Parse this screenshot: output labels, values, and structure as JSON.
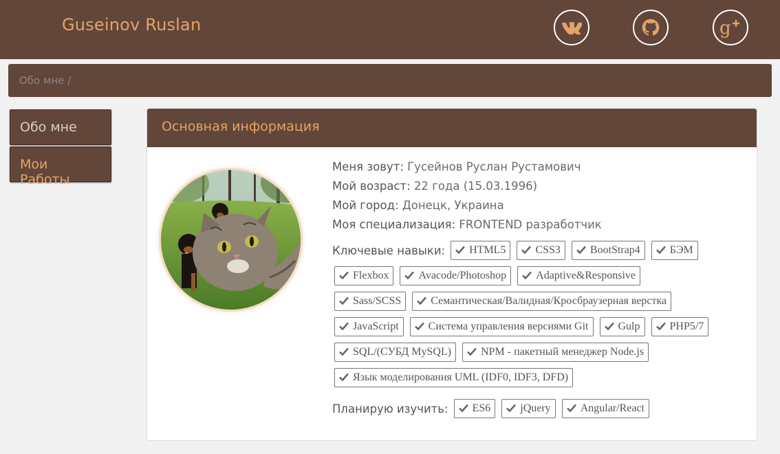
{
  "header": {
    "brand": "Guseinov Ruslan",
    "social": [
      {
        "icon": "vk-icon"
      },
      {
        "icon": "github-icon"
      },
      {
        "icon": "google-plus-icon"
      }
    ]
  },
  "breadcrumb": {
    "text": "Обо мне /"
  },
  "nav": {
    "items": [
      {
        "label": "Обо мне"
      },
      {
        "label": "Мои Работы"
      }
    ]
  },
  "card": {
    "title": "Основная информация",
    "info": [
      {
        "key": "Меня зовут:",
        "value": " Гусейнов Руслан Рустамович"
      },
      {
        "key": "Мой возраст:",
        "value": " 22 года (15.03.1996)"
      },
      {
        "key": "Мой город:",
        "value": " Донецк, Украина"
      },
      {
        "key": "Моя специализация:",
        "value": " FRONTEND разработчик"
      }
    ],
    "skills_label": "Ключевые навыки:",
    "skill_rows": [
      [
        "HTML5",
        "CSS3",
        "BootStrap4",
        "БЭМ"
      ],
      [
        "Flexbox",
        "Avacode/Photoshop",
        "Adaptive&Responsive"
      ],
      [
        "Sass/SCSS",
        "Семантическая/Валидная/Кросбраузерная верстка"
      ],
      [
        "JavaScript",
        "Система управления версиями Git",
        "Gulp",
        "PHP5/7"
      ],
      [
        "SQL/(СУБД MySQL)",
        "NPM - пакетный менеджер Node.js"
      ],
      [
        "Язык моделирования UML (IDF0, IDF3, DFD)"
      ]
    ],
    "plan_label": "Планирую изучить:",
    "plan": [
      "ES6",
      "jQuery",
      "Angular/React"
    ]
  },
  "colors": {
    "brown": "#62463a",
    "accent": "#e2a46a",
    "background": "#f1f1f1"
  }
}
